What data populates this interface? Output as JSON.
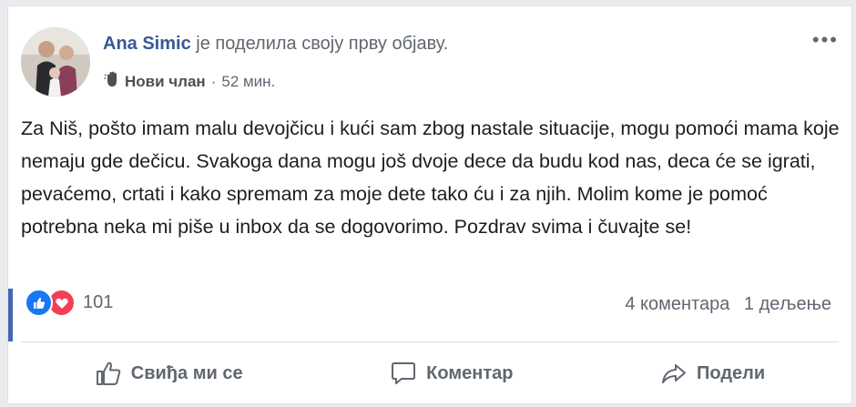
{
  "post": {
    "author": "Ana Simic",
    "action": "је поделила своју прву објаву.",
    "badge": "Нови члан",
    "separator": "·",
    "time": "52 мин.",
    "text": "Za Niš, pošto imam malu devojčicu i kući sam zbog nastale situacije, mogu pomoći mama koje nemaju gde dečicu. Svakoga dana mogu još dvoje dece da budu kod nas, deca će se igrati, pevaćemo, crtati i kako spremam za moje dete tako ću i za njih. Molim kome je pomoć potrebna neka mi piše u inbox da se dogovorimo. Pozdrav svima i čuvajte se!"
  },
  "reactions": {
    "count": "101",
    "types": [
      "like-icon",
      "love-icon"
    ]
  },
  "stats": {
    "comments": "4 коментара",
    "shares": "1 дељење"
  },
  "actions": {
    "like": "Свиђа ми се",
    "comment": "Коментар",
    "share": "Подели"
  },
  "colors": {
    "author": "#385898",
    "like_blue": "#1877f2",
    "love_red": "#f33e58",
    "accent_bar": "#4267b2"
  }
}
